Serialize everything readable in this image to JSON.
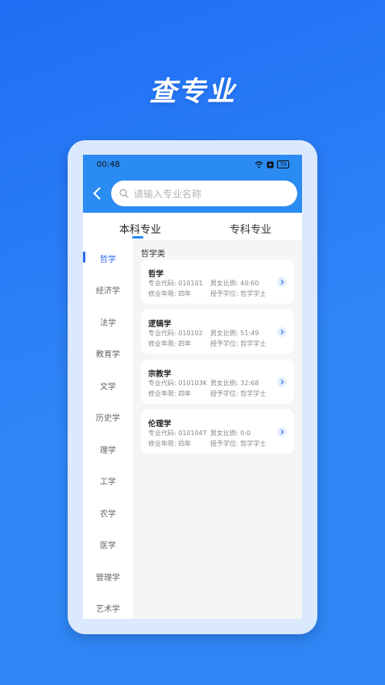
{
  "hero": {
    "title": "查专业"
  },
  "status": {
    "time": "00:48",
    "battery": "70"
  },
  "search": {
    "placeholder": "请输入专业名称"
  },
  "tabs": [
    {
      "label": "本科专业"
    },
    {
      "label": "专科专业"
    }
  ],
  "sidebar": {
    "items": [
      "哲学",
      "经济学",
      "法学",
      "教育学",
      "文学",
      "历史学",
      "理学",
      "工学",
      "农学",
      "医学",
      "管理学",
      "艺术学"
    ]
  },
  "category": {
    "title": "哲学类"
  },
  "majors": [
    {
      "name": "哲学",
      "code_label": "专业代码: 010101",
      "ratio_label": "男女比例: 40:60",
      "years_label": "修业年限: 四年",
      "degree_label": "授予学位: 哲学学士"
    },
    {
      "name": "逻辑学",
      "code_label": "专业代码: 010102",
      "ratio_label": "男女比例: 51:49",
      "years_label": "修业年限: 四年",
      "degree_label": "授予学位: 哲学学士"
    },
    {
      "name": "宗教学",
      "code_label": "专业代码: 010103K",
      "ratio_label": "男女比例: 32:68",
      "years_label": "修业年限: 四年",
      "degree_label": "授予学位: 哲学学士"
    },
    {
      "name": "伦理学",
      "code_label": "专业代码: 010104T",
      "ratio_label": "男女比例: 0:0",
      "years_label": "修业年限: 四年",
      "degree_label": "授予学位: 哲学学士"
    }
  ],
  "colors": {
    "accent": "#2a8bf2",
    "background": "#1f6ef5"
  }
}
